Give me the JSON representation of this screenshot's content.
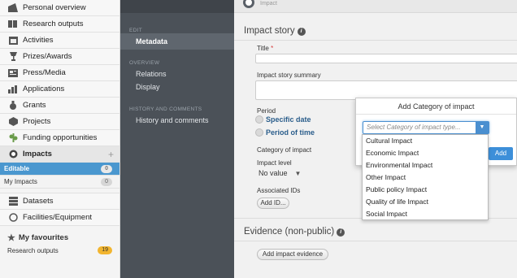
{
  "sidebar": {
    "items": [
      {
        "label": "Personal overview",
        "icon": "personal-overview-icon"
      },
      {
        "label": "Research outputs",
        "icon": "book-icon"
      },
      {
        "label": "Activities",
        "icon": "calendar-icon"
      },
      {
        "label": "Prizes/Awards",
        "icon": "trophy-icon"
      },
      {
        "label": "Press/Media",
        "icon": "newspaper-icon"
      },
      {
        "label": "Applications",
        "icon": "bars-icon"
      },
      {
        "label": "Grants",
        "icon": "money-bag-icon"
      },
      {
        "label": "Projects",
        "icon": "cube-icon"
      },
      {
        "label": "Funding opportunities",
        "icon": "funding-icon"
      }
    ],
    "impacts": {
      "label": "Impacts",
      "plus": "+"
    },
    "sub_items": [
      {
        "label": "Editable",
        "count": "0"
      },
      {
        "label": "My Impacts",
        "count": "0"
      }
    ],
    "items_after": [
      {
        "label": "Datasets",
        "icon": "database-icon"
      },
      {
        "label": "Facilities/Equipment",
        "icon": "equipment-icon"
      }
    ],
    "favourites": {
      "title": "My favourites",
      "row_label": "Research outputs",
      "row_count": "19"
    }
  },
  "editor_nav": {
    "edit_heading": "EDIT",
    "metadata": "Metadata",
    "overview_heading": "OVERVIEW",
    "relations": "Relations",
    "display": "Display",
    "history_heading": "HISTORY AND COMMENTS",
    "history_link": "History and comments"
  },
  "header": {
    "label": "Impact"
  },
  "form": {
    "section_title": "Impact story",
    "title_label": "Title",
    "required_mark": "*",
    "summary_label": "Impact story summary",
    "period_label": "Period",
    "specific_date": "Specific date",
    "period_of_time": "Period of time",
    "category_label": "Category of impact",
    "level_label": "Impact level",
    "level_value": "No value",
    "ids_label": "Associated IDs",
    "add_id_button": "Add ID...",
    "evidence_title": "Evidence (non-public)",
    "add_evidence_button": "Add impact evidence"
  },
  "modal": {
    "title": "Add Category of impact",
    "select_placeholder": "Select Category of impact type...",
    "add_button": "Add",
    "options": [
      "Cultural Impact",
      "Economic Impact",
      "Environmental Impact",
      "Other Impact",
      "Public policy Impact",
      "Quality of life Impact",
      "Social Impact"
    ]
  },
  "colors": {
    "accent": "#4a97cf",
    "favourite_badge": "#f2b52f",
    "mid_panel": "#4b5158"
  }
}
